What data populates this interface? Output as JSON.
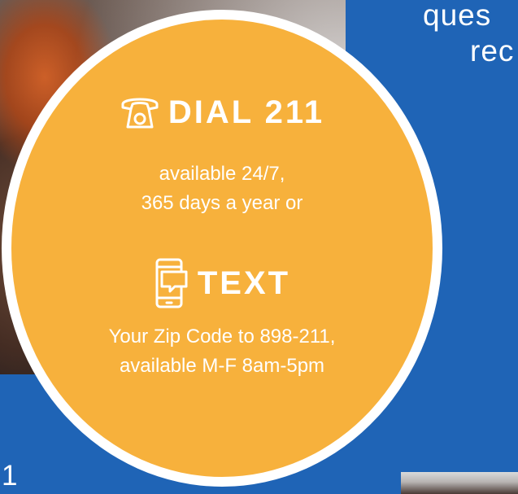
{
  "background": {
    "top_right_text": "ques",
    "top_right_text_2": "rec",
    "bottom_left_text": "1"
  },
  "dial": {
    "icon": "phone-icon",
    "title": "DIAL 211",
    "line1": "available 24/7,",
    "line2": "365 days a year or"
  },
  "text_section": {
    "icon": "mobile-message-icon",
    "title": "TEXT",
    "line1": "Your Zip Code to 898-211,",
    "line2": "available M-F 8am-5pm"
  },
  "colors": {
    "circle": "#f7b13c",
    "panel_blue": "#1f64b6",
    "ring": "#ffffff",
    "text": "#ffffff"
  }
}
